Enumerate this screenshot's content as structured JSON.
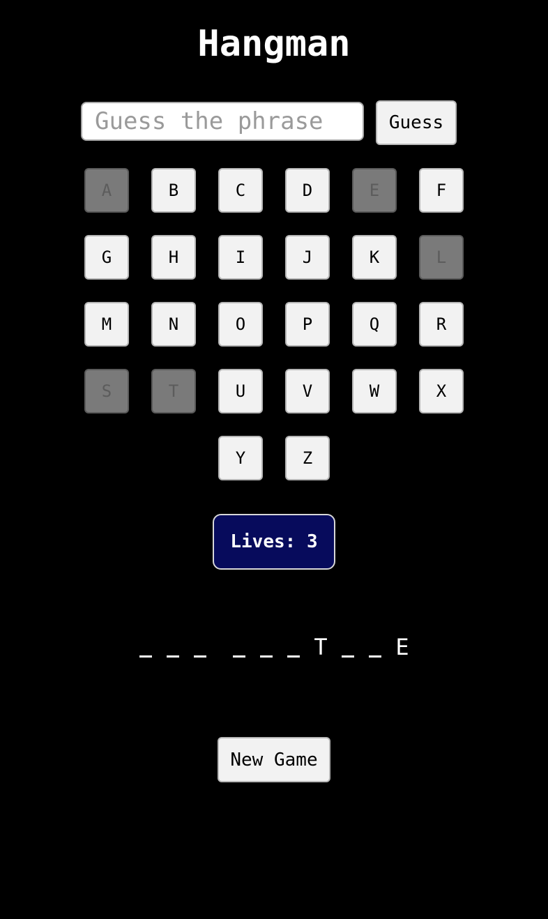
{
  "title": "Hangman",
  "guess": {
    "placeholder": "Guess the phrase",
    "value": "",
    "button_label": "Guess"
  },
  "keyboard": {
    "keys": [
      {
        "letter": "A",
        "used": true
      },
      {
        "letter": "B",
        "used": false
      },
      {
        "letter": "C",
        "used": false
      },
      {
        "letter": "D",
        "used": false
      },
      {
        "letter": "E",
        "used": true
      },
      {
        "letter": "F",
        "used": false
      },
      {
        "letter": "G",
        "used": false
      },
      {
        "letter": "H",
        "used": false
      },
      {
        "letter": "I",
        "used": false
      },
      {
        "letter": "J",
        "used": false
      },
      {
        "letter": "K",
        "used": false
      },
      {
        "letter": "L",
        "used": true
      },
      {
        "letter": "M",
        "used": false
      },
      {
        "letter": "N",
        "used": false
      },
      {
        "letter": "O",
        "used": false
      },
      {
        "letter": "P",
        "used": false
      },
      {
        "letter": "Q",
        "used": false
      },
      {
        "letter": "R",
        "used": false
      },
      {
        "letter": "S",
        "used": true
      },
      {
        "letter": "T",
        "used": true
      },
      {
        "letter": "U",
        "used": false
      },
      {
        "letter": "V",
        "used": false
      },
      {
        "letter": "W",
        "used": false
      },
      {
        "letter": "X",
        "used": false
      },
      {
        "letter": "Y",
        "used": false
      },
      {
        "letter": "Z",
        "used": false
      }
    ]
  },
  "lives": {
    "label": "Lives: 3",
    "count": 3,
    "color": "#070b5c"
  },
  "phrase": {
    "words": [
      [
        "",
        "",
        ""
      ],
      [
        "",
        "",
        "",
        "T",
        "",
        "",
        "E"
      ]
    ]
  },
  "new_game_label": "New Game"
}
